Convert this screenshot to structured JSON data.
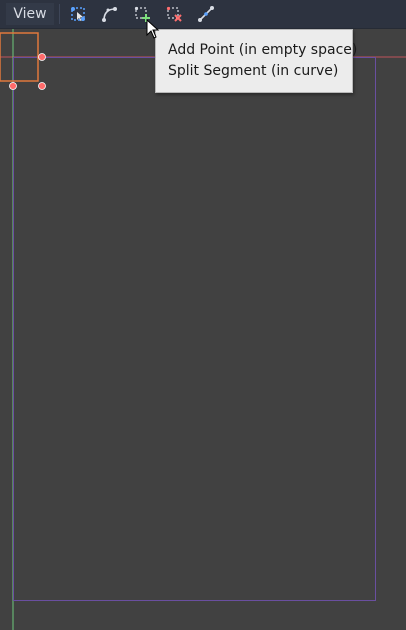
{
  "toolbar": {
    "view_label": "View",
    "tools": [
      {
        "icon": "select-points-icon",
        "color": "#5aa2ff"
      },
      {
        "icon": "edit-curve-icon",
        "color": "#d8dce4"
      },
      {
        "icon": "add-point-icon",
        "color": "#7ee07e"
      },
      {
        "icon": "delete-point-icon",
        "color": "#ff6e6e"
      },
      {
        "icon": "close-curve-icon",
        "color": "#d8dce4"
      }
    ]
  },
  "tooltip": {
    "line1": "Add Point (in empty space)",
    "line2": "Split Segment (in curve)"
  },
  "colors": {
    "background": "#414141",
    "toolbar": "#2d3340",
    "x_axis": "#c0545b",
    "y_axis": "#6dc97a",
    "viewport_border": "#7a5ab3",
    "selection": "#e0783c",
    "handle": "#ff6b6b"
  }
}
